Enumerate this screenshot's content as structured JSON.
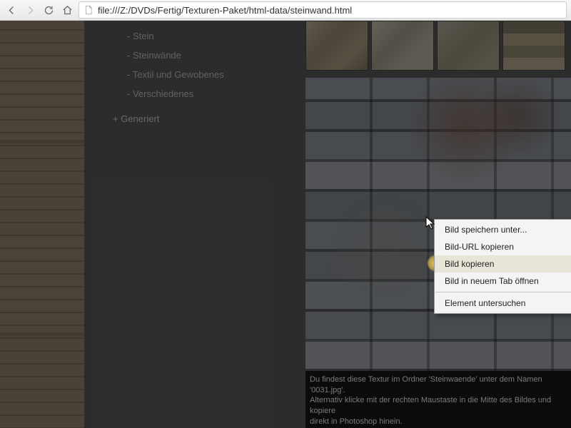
{
  "browser": {
    "url": "file:///Z:/DVDs/Fertig/Texturen-Paket/html-data/steinwand.html"
  },
  "sidebar": {
    "items": [
      {
        "label": "Stein"
      },
      {
        "label": "Steinwände"
      },
      {
        "label": "Textil und Gewobenes"
      },
      {
        "label": "Verschiedenes"
      }
    ],
    "group": "Generiert"
  },
  "caption": {
    "line1": "Du findest diese Textur im Ordner 'Steinwaende' unter dem Namen '0031.jpg'.",
    "line2": "Alternativ klicke mit der rechten Maustaste in die Mitte des Bildes und kopiere",
    "line3": "direkt in Photoshop hinein."
  },
  "context_menu": {
    "items": [
      {
        "label": "Bild speichern unter...",
        "hover": false
      },
      {
        "label": "Bild-URL kopieren",
        "hover": false
      },
      {
        "label": "Bild kopieren",
        "hover": true
      },
      {
        "label": "Bild in neuem Tab öffnen",
        "hover": false
      }
    ],
    "inspect": "Element untersuchen"
  }
}
